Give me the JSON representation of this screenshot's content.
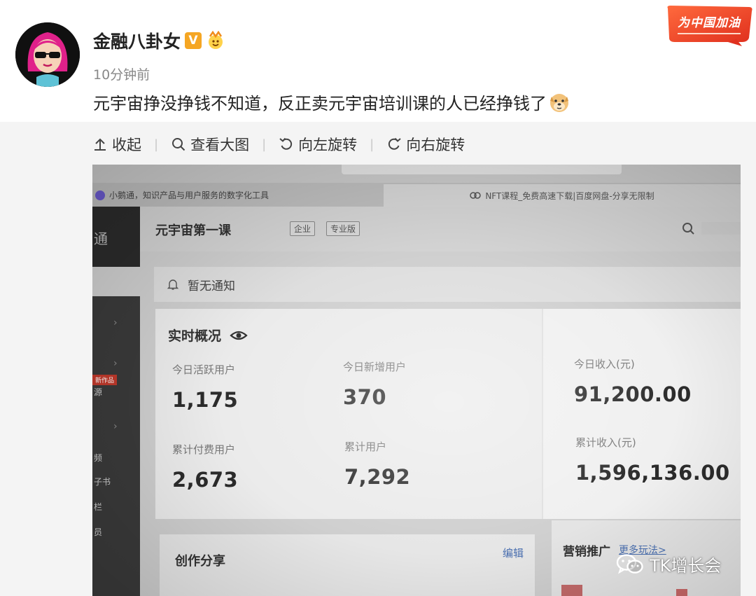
{
  "post": {
    "author": "金融八卦女",
    "verified_badge": "V",
    "time": "10分钟前",
    "text": "元宇宙挣没挣钱不知道，反正卖元宇宙培训课的人已经挣钱了",
    "cheer_badge": "为中国加油"
  },
  "toolbar": {
    "collapse": "收起",
    "view_large": "查看大图",
    "rotate_left": "向左旋转",
    "rotate_right": "向右旋转"
  },
  "photo": {
    "browser_tab_left": "小鹅通，知识产品与用户服务的数字化工具",
    "browser_tab_right": "NFT课程_免费高速下载|百度网盘-分享无限制",
    "course_title": "元宇宙第一课",
    "tags": [
      "企业",
      "专业版"
    ],
    "notice": "暂无通知",
    "stats_title": "实时概况",
    "stats": {
      "active_users_label": "今日活跃用户",
      "active_users": "1,175",
      "new_users_label": "今日新增用户",
      "new_users": "370",
      "income_today_label": "今日收入(元)",
      "income_today": "91,200.00",
      "paid_users_label": "累计付费用户",
      "paid_users": "2,673",
      "total_users_label": "累计用户",
      "total_users": "7,292",
      "income_total_label": "累计收入(元)",
      "income_total": "1,596,136.00"
    },
    "sidebar_fragments": [
      "通",
      "源",
      "频",
      "子书",
      "栏",
      "员"
    ],
    "sidebar_badge": "新作品",
    "creation_share": "创作分享",
    "edit": "编辑",
    "marketing": "营销推广",
    "more_methods": "更多玩法>"
  },
  "watermark": "TK增长会",
  "colors": {
    "badge_orange": "#f5a623",
    "cheer_red": "#e8402a",
    "link_blue": "#4a6fb0"
  }
}
